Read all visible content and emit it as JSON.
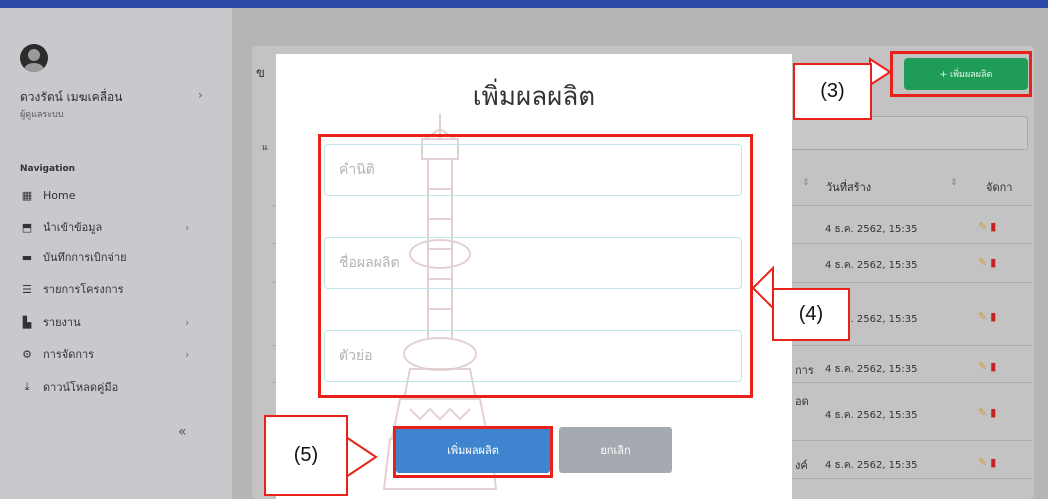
{
  "sidebar": {
    "user_name": "ดวงรัตน์ เมฆเคลื่อน",
    "user_role": "ผู้ดูแลระบบ",
    "nav_heading": "Navigation",
    "items": [
      {
        "label": "Home",
        "icon": "grid-icon",
        "has_arrow": false
      },
      {
        "label": "นำเข้าข้อมูล",
        "icon": "import-icon",
        "has_arrow": true
      },
      {
        "label": "บันทึกการเบิกจ่าย",
        "icon": "money-icon",
        "has_arrow": false
      },
      {
        "label": "รายการโครงการ",
        "icon": "list-icon",
        "has_arrow": false
      },
      {
        "label": "รายงาน",
        "icon": "report-icon",
        "has_arrow": true
      },
      {
        "label": "การจัดการ",
        "icon": "settings-icon",
        "has_arrow": true
      },
      {
        "label": "ดาวน์โหลดคู่มือ",
        "icon": "download-icon",
        "has_arrow": false
      }
    ],
    "collapse_label": "«"
  },
  "page": {
    "add_button_label": "+ เพิ่มผลผลิต",
    "table_headers": {
      "created": "วันที่สร้าง",
      "manage": "จัดกา"
    },
    "rows": [
      {
        "partial": "",
        "date": "4 ธ.ค. 2562, 15:35"
      },
      {
        "partial": "",
        "date": "4 ธ.ค. 2562, 15:35"
      },
      {
        "partial": "",
        "date": "4 ธ.ค. 2562, 15:35"
      },
      {
        "partial": "การ",
        "date": "4 ธ.ค. 2562, 15:35"
      },
      {
        "partial": "อด",
        "date": "4 ธ.ค. 2562, 15:35"
      },
      {
        "partial": "งค์",
        "date": "4 ธ.ค. 2562, 15:35"
      }
    ]
  },
  "modal": {
    "title": "เพิ่มผลผลิต",
    "fields": [
      {
        "placeholder": "คำนิติ",
        "value": ""
      },
      {
        "placeholder": "ชื่อผลผลิต",
        "value": ""
      },
      {
        "placeholder": "ตัวย่อ",
        "value": ""
      }
    ],
    "submit_label": "เพิ่มผลผลิต",
    "cancel_label": "ยกเลิก"
  },
  "annotations": {
    "callout_3": "(3)",
    "callout_4": "(4)",
    "callout_5": "(5)",
    "color": "#e8221b"
  }
}
